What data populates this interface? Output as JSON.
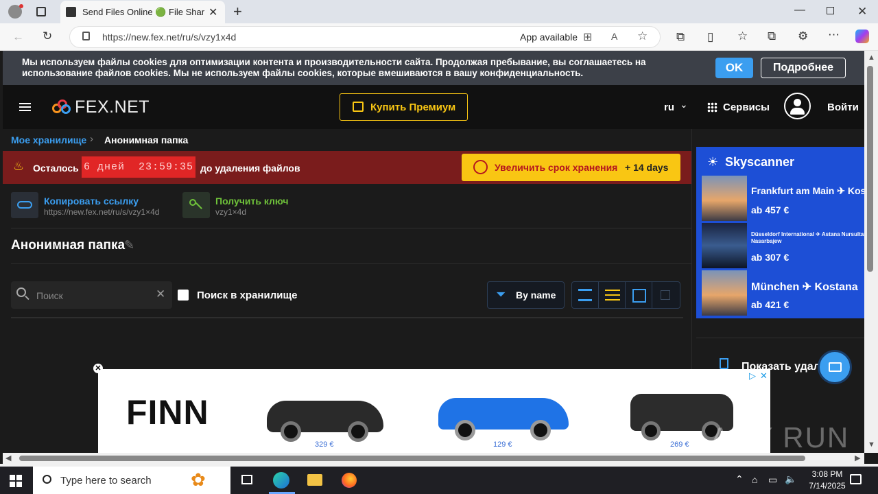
{
  "browser": {
    "tab_title": "Send Files Online 🟢 File Sharing",
    "url": "https://new.fex.net/ru/s/vzy1x4d",
    "app_available": "App available"
  },
  "cookie": {
    "text": "Мы используем файлы cookies для оптимизации контента и производительности сайта. Продолжая пребывание, вы соглашаетесь на использование файлов cookies. Мы не используем файлы cookies, которые вмешиваются в вашу конфиденциальность.",
    "ok": "OK",
    "more": "Подробнее"
  },
  "header": {
    "logo": "FEX.NET",
    "premium": "Купить Премиум",
    "lang": "ru",
    "services": "Сервисы",
    "login": "Войти"
  },
  "breadcrumb": {
    "root": "Мое хранилище",
    "current": "Анонимная папка"
  },
  "alert": {
    "left": "Осталось",
    "timer": "6 дней  23:59:35",
    "right": "до удаления файлов",
    "extend": "Увеличить срок хранения",
    "extend_plus": "+ 14 days"
  },
  "share": {
    "copy_label": "Копировать ссылку",
    "copy_url": "https://new.fex.net/ru/s/vzy1×4d",
    "key_label": "Получить ключ",
    "key_value": "vzy1×4d"
  },
  "folder": {
    "title": "Анонимная папка"
  },
  "toolbar": {
    "search_placeholder": "Поиск",
    "storage_search": "Поиск в хранилище",
    "sort": "By name"
  },
  "sidebar": {
    "brand": "Skyscanner",
    "deals": [
      {
        "route": "Frankfurt am Main ✈ Kos",
        "price": "ab 457 €"
      },
      {
        "route": "Düsseldorf International ✈ Astana Nursultan Nasarbajew",
        "price": "ab 307 €"
      },
      {
        "route": "München ✈ Kostana",
        "price": "ab 421 €"
      }
    ],
    "show_deleted": "Показать удал"
  },
  "ad": {
    "brand": "FINN",
    "prices": [
      "329 €",
      "129 €",
      "269 €"
    ],
    "car_colors": [
      "#2a2a2a",
      "#1f73e6",
      "#2c2c2c"
    ]
  },
  "watermark": "ANY RUN",
  "taskbar": {
    "search": "Type here to search",
    "time": "3:08 PM",
    "date": "7/14/2025"
  }
}
